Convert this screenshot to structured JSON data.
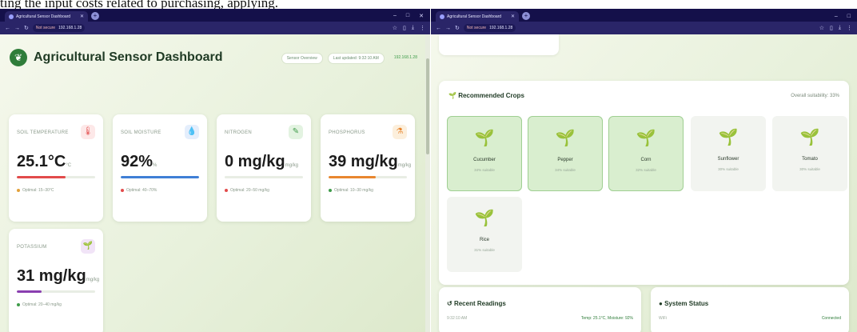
{
  "caption": "ting the input costs related to purchasing, applying.",
  "left_window": {
    "tab_title": "Agricultural Sensor Dashboard",
    "url_label": "Not secure",
    "url": "192.168.1.28",
    "header": {
      "title": "Agricultural Sensor Dashboard",
      "sensor_btn": "Sensor Overview",
      "last_updated": "Last updated: 9:32:10 AM",
      "address": "192.168.1.28"
    },
    "cards": [
      {
        "label": "SOIL TEMPERATURE",
        "value": "25.1°C",
        "unit": "°C",
        "optimal": "Optimal: 15–30°C",
        "fill": 0.62,
        "bar_color": "#e24b4b",
        "icon": "thermometer-icon",
        "icon_glyph": "🌡",
        "icon_bg": "#fde8e8",
        "dot": "#e2a13a"
      },
      {
        "label": "SOIL MOISTURE",
        "value": "92%",
        "unit": "%",
        "optimal": "Optimal: 40–70%",
        "fill": 1.0,
        "bar_color": "#3f7fd6",
        "icon": "water-drop-icon",
        "icon_glyph": "💧",
        "icon_bg": "#e4eefc",
        "dot": "#e24b4b"
      },
      {
        "label": "NITROGEN",
        "value": "0 mg/kg",
        "unit": "mg/kg",
        "optimal": "Optimal: 20–50 mg/kg",
        "fill": 0.0,
        "bar_color": "#3f9c4a",
        "icon": "leaf-pen-icon",
        "icon_glyph": "✎",
        "icon_bg": "#e3f3e1",
        "dot": "#e24b4b"
      },
      {
        "label": "PHOSPHORUS",
        "value": "39 mg/kg",
        "unit": "mg/kg",
        "optimal": "Optimal: 10–30 mg/kg",
        "fill": 0.6,
        "bar_color": "#e8862f",
        "icon": "flask-icon",
        "icon_glyph": "⚗",
        "icon_bg": "#fcefdc",
        "dot": "#3f9c4a"
      },
      {
        "label": "POTASSIUM",
        "value": "31 mg/kg",
        "unit": "mg/kg",
        "optimal": "Optimal: 20–40 mg/kg",
        "fill": 0.32,
        "bar_color": "#8a3fb0",
        "icon": "sprout-icon",
        "icon_glyph": "🌱",
        "icon_bg": "#f1e4f7",
        "dot": "#3f9c4a"
      }
    ]
  },
  "right_window": {
    "tab_title": "Agricultural Sensor Dashboard",
    "url_label": "Not secure",
    "url": "192.168.1.28",
    "crops_panel": {
      "title": "Recommended Crops",
      "overall": "Overall suitability: 33%",
      "crops": [
        {
          "name": "Cucumber",
          "score": "34% suitable",
          "highlight": true
        },
        {
          "name": "Pepper",
          "score": "34% suitable",
          "highlight": true
        },
        {
          "name": "Corn",
          "score": "32% suitable",
          "highlight": true
        },
        {
          "name": "Sunflower",
          "score": "30% suitable",
          "highlight": false
        },
        {
          "name": "Tomato",
          "score": "30% suitable",
          "highlight": false
        },
        {
          "name": "Rice",
          "score": "31% suitable",
          "highlight": false
        }
      ]
    },
    "recent_readings": {
      "title": "Recent Readings",
      "time": "9:32:10 AM",
      "summary": "Temp: 25.1°C, Moisture: 92%"
    },
    "system_status": {
      "title": "System Status",
      "label": "WiFi",
      "value": "Connected"
    }
  },
  "colors": {
    "accent_green": "#2f7d3a",
    "tabbar": "#14104a"
  }
}
